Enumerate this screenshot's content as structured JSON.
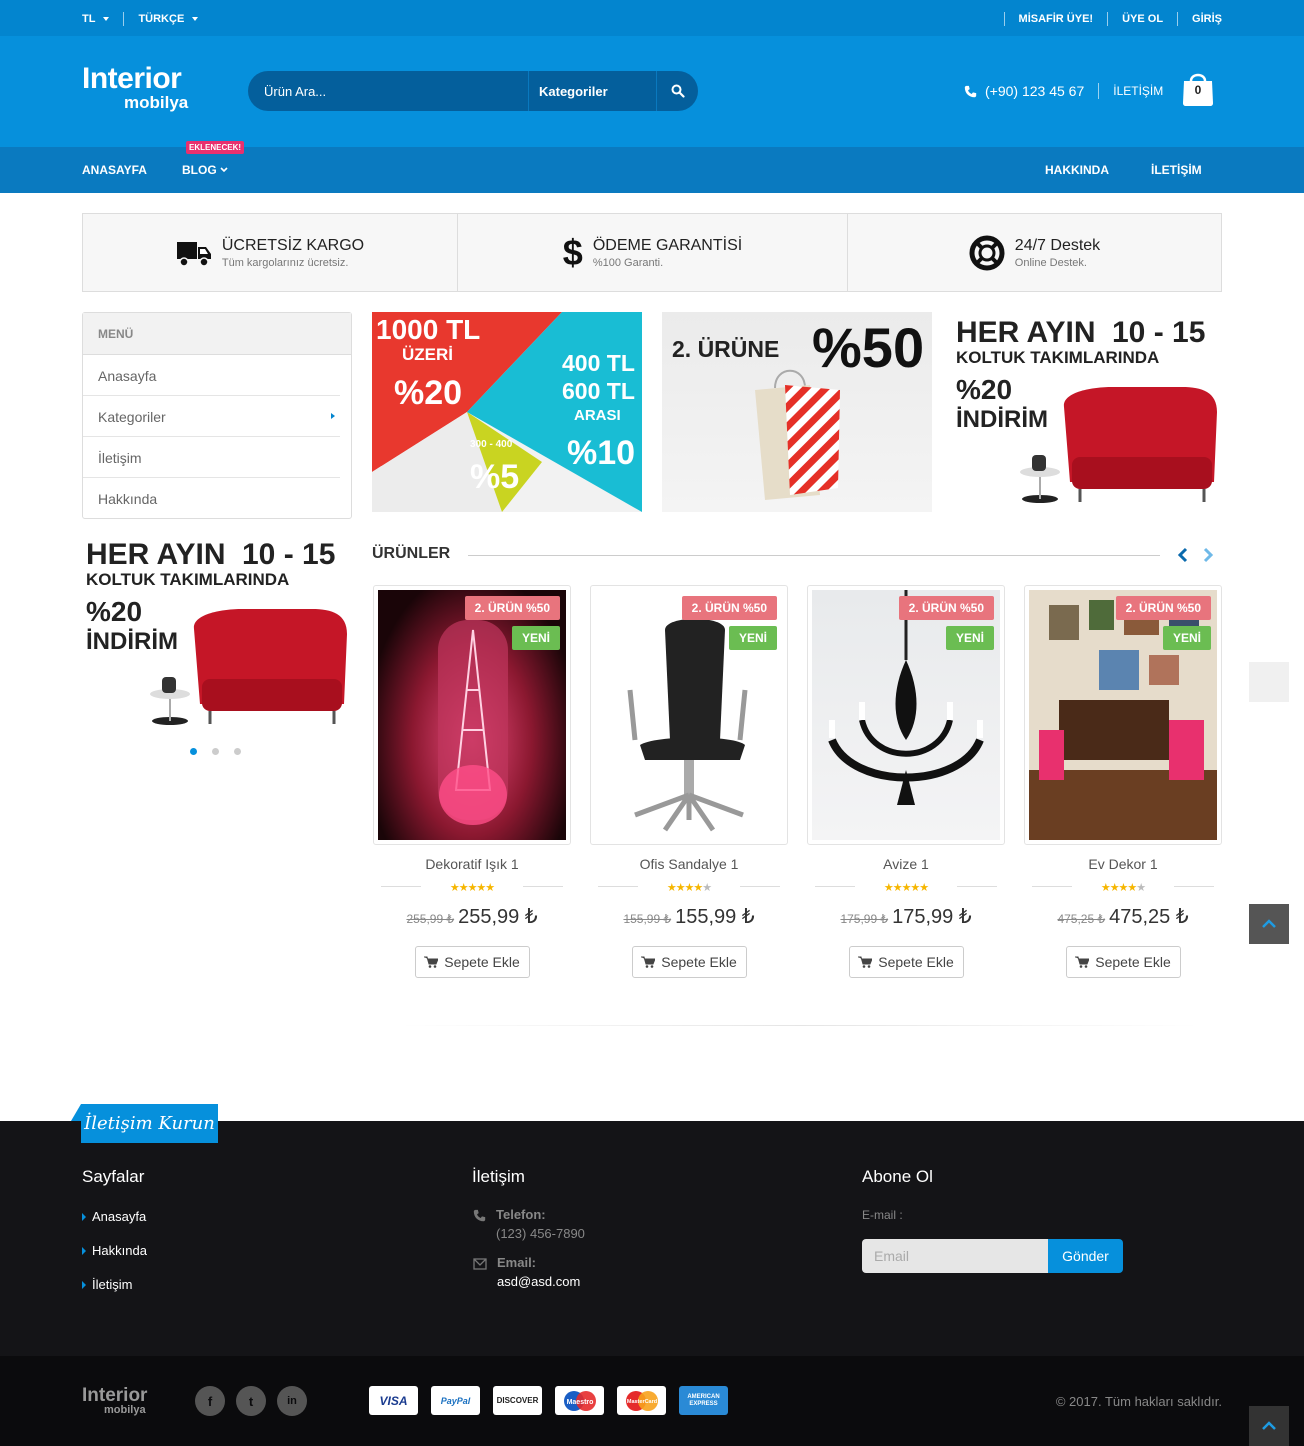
{
  "topbar": {
    "currency": "TL",
    "language": "TÜRKÇE",
    "guest": "MİSAFİR ÜYE!",
    "register": "ÜYE OL",
    "login": "GİRİŞ"
  },
  "header": {
    "logo_main": "Interior",
    "logo_sub": "mobilya",
    "search_placeholder": "Ürün Ara...",
    "categories_label": "Kategoriler",
    "phone": "(+90) 123 45 67",
    "contact_link": "İLETİŞİM",
    "cart_count": "0"
  },
  "nav": {
    "home": "ANASAYFA",
    "blog": "BLOG",
    "blog_badge": "EKLENECEK!",
    "about": "HAKKINDA",
    "contact": "İLETİŞİM"
  },
  "features": [
    {
      "title": "ÜCRETSİZ KARGO",
      "subtitle": "Tüm kargolarınız ücretsiz.",
      "icon": "truck-icon"
    },
    {
      "title": "ÖDEME GARANTİSİ",
      "subtitle": "%100 Garanti.",
      "icon": "dollar-icon"
    },
    {
      "title": "24/7 Destek",
      "subtitle": "Online Destek.",
      "icon": "lifebuoy-icon"
    }
  ],
  "menu": {
    "title": "MENÜ",
    "items": [
      "Anasayfa",
      "Kategoriler",
      "İletişim",
      "Hakkında"
    ]
  },
  "banners": {
    "b1": {
      "t1": "1000 TL",
      "t2": "ÜZERİ",
      "t3": "%20",
      "t4": "400 TL",
      "t5": "600 TL",
      "t6": "ARASI",
      "t7": "%10",
      "t8": "300 - 400",
      "t9": "%5"
    },
    "b2": {
      "t1": "2. ÜRÜNE",
      "t2": "%50"
    },
    "b3": {
      "t1": "HER AYIN",
      "t2": "10 - 15",
      "t3": "KOLTUK TAKIMLARINDA",
      "t4": "%20",
      "t5": "İNDİRİM"
    },
    "side": {
      "t1": "HER AYIN",
      "t2": "10 - 15",
      "t3": "KOLTUK TAKIMLARINDA",
      "t4": "%20",
      "t5": "İNDİRİM"
    }
  },
  "products_section": {
    "title": "ÜRÜNLER",
    "items": [
      {
        "name": "Dekoratif Işık 1",
        "old_price": "255,99 ₺",
        "price": "255,99 ₺",
        "sale_tag": "2. ÜRÜN %50",
        "new_tag": "YENİ",
        "rating": 4.5,
        "add_label": "Sepete Ekle"
      },
      {
        "name": "Ofis Sandalye 1",
        "old_price": "155,99 ₺",
        "price": "155,99 ₺",
        "sale_tag": "2. ÜRÜN %50",
        "new_tag": "YENİ",
        "rating": 4,
        "add_label": "Sepete Ekle"
      },
      {
        "name": "Avize 1",
        "old_price": "175,99 ₺",
        "price": "175,99 ₺",
        "sale_tag": "2. ÜRÜN %50",
        "new_tag": "YENİ",
        "rating": 4.5,
        "add_label": "Sepete Ekle"
      },
      {
        "name": "Ev Dekor 1",
        "old_price": "475,25 ₺",
        "price": "475,25 ₺",
        "sale_tag": "2. ÜRÜN %50",
        "new_tag": "YENİ",
        "rating": 4,
        "add_label": "Sepete Ekle"
      }
    ]
  },
  "footer": {
    "tab_label": "İletişim Kurun",
    "pages_title": "Sayfalar",
    "pages": [
      "Anasayfa",
      "Hakkında",
      "İletişim"
    ],
    "contact_title": "İletişim",
    "phone_label": "Telefon:",
    "phone_value": "(123) 456-7890",
    "email_label": "Email:",
    "email_value": "asd@asd.com",
    "subscribe_title": "Abone Ol",
    "email_field_label": "E-mail :",
    "email_placeholder": "Email",
    "send_label": "Gönder"
  },
  "bottom": {
    "logo_main": "Interior",
    "logo_sub": "mobilya",
    "social": [
      "f",
      "t",
      "in"
    ],
    "payments": [
      "VISA",
      "PayPal",
      "DISCOVER",
      "Maestro",
      "MasterCard",
      "AMERICAN EXPRESS"
    ],
    "copyright": "© 2017. Tüm hakları saklıdır."
  },
  "colors": {
    "primary": "#0690dc",
    "topbar": "#0385cf",
    "nav": "#0a7ac0",
    "sale": "#e8747d",
    "new": "#6bbd52",
    "star": "#f6b600"
  }
}
